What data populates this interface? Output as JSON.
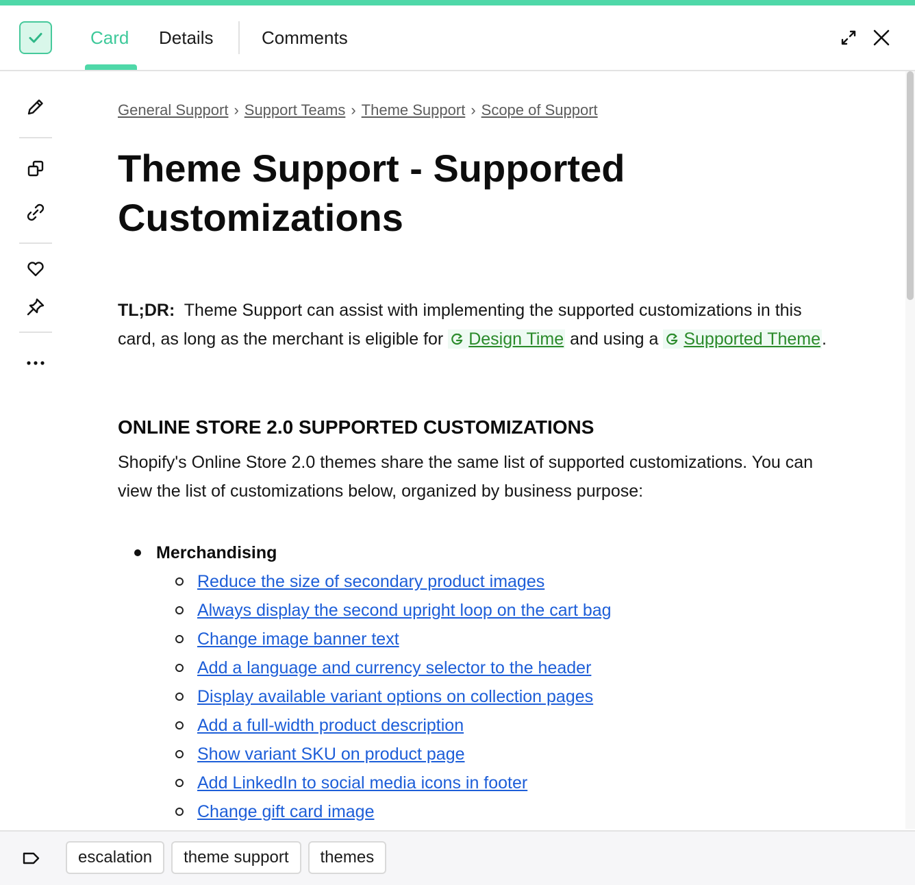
{
  "header": {
    "tabs": [
      {
        "label": "Card"
      },
      {
        "label": "Details"
      },
      {
        "label": "Comments"
      }
    ]
  },
  "breadcrumb": [
    "General Support",
    "Support Teams",
    "Theme Support",
    "Scope of Support"
  ],
  "page": {
    "title": "Theme Support - Supported Customizations",
    "tldr": {
      "label": "TL;DR:",
      "text1": "Theme Support can assist with implementing the supported customizations in this card, as long as the merchant is eligible for",
      "link1": "Design Time",
      "text2": "and using a",
      "link2": "Supported Theme",
      "text3": "."
    },
    "section_heading": "ONLINE STORE 2.0 SUPPORTED CUSTOMIZATIONS",
    "section_text": "Shopify's Online Store 2.0 themes share the same list of supported customizations. You can view the list of customizations below, organized by business purpose:",
    "list": {
      "heading": "Merchandising",
      "items": [
        "Reduce the size of secondary product images",
        "Always display the second upright loop on the cart bag",
        "Change image banner text",
        "Add a language and currency selector to the header",
        "Display available variant options on collection pages",
        "Add a full-width product description",
        "Show variant SKU on product page",
        "Add LinkedIn to social media icons in footer",
        "Change gift card image"
      ]
    }
  },
  "footer": {
    "tags": [
      "escalation",
      "theme support",
      "themes"
    ]
  },
  "colors": {
    "accent": "#4fd8a8",
    "link_blue": "#1d5ed8",
    "card_link_green": "#2a8a2a"
  }
}
